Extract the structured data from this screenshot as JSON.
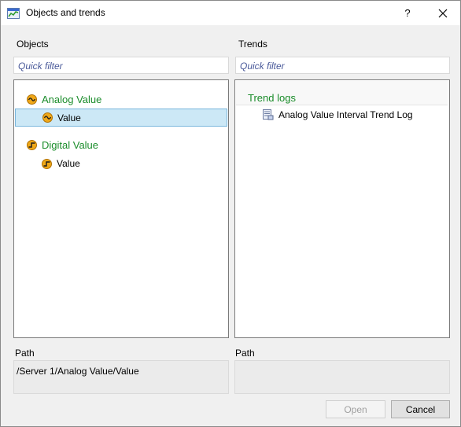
{
  "window": {
    "title": "Objects and trends",
    "help_glyph": "?"
  },
  "objects": {
    "label": "Objects",
    "filter_placeholder": "Quick filter",
    "tree": [
      {
        "label": "Analog Value",
        "icon": "analog-value-icon",
        "children": [
          {
            "label": "Value",
            "icon": "analog-value-icon",
            "selected": true
          }
        ]
      },
      {
        "label": "Digital Value",
        "icon": "digital-value-icon",
        "children": [
          {
            "label": "Value",
            "icon": "digital-value-icon",
            "selected": false
          }
        ]
      }
    ],
    "path_label": "Path",
    "path_value": "/Server 1/Analog Value/Value"
  },
  "trends": {
    "label": "Trends",
    "filter_placeholder": "Quick filter",
    "group": "Trend logs",
    "items": [
      {
        "label": "Analog Value Interval Trend Log",
        "icon": "trend-log-icon"
      }
    ],
    "path_label": "Path",
    "path_value": ""
  },
  "buttons": {
    "open": "Open",
    "cancel": "Cancel"
  },
  "colors": {
    "group_text": "#1a8c2a",
    "selection": "#cce8f6",
    "filter_text": "#4a5a9a"
  }
}
